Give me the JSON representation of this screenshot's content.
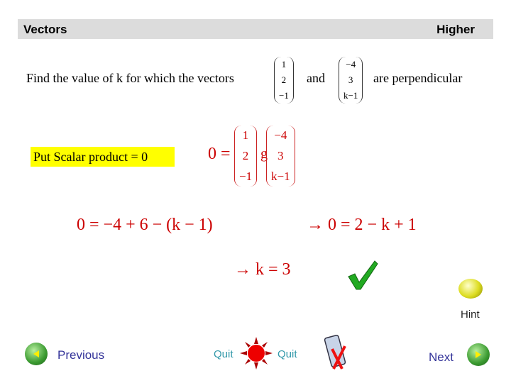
{
  "header": {
    "title": "Vectors",
    "level": "Higher"
  },
  "question": {
    "prefix": "Find the value of  k  for which the vectors",
    "and": "and",
    "suffix": "are perpendicular",
    "vector_a": [
      "1",
      "2",
      "−1"
    ],
    "vector_b": [
      "−4",
      "3",
      "k−1"
    ]
  },
  "hint_box": "Put Scalar product = 0",
  "working": {
    "zero_eq": "0 =",
    "dot": "g",
    "step1": "0 = −4 + 6 − (k − 1)",
    "step2": "→  0 = 2 − k + 1",
    "step3": "→  k = 3"
  },
  "hint": {
    "label": "Hint"
  },
  "nav": {
    "previous": "Previous",
    "quit_left": "Quit",
    "quit_right": "Quit",
    "next": "Next"
  },
  "colors": {
    "header_bg": "#dcdcdc",
    "highlight": "#ffff00",
    "working": "#cc0000",
    "nav_text": "#333399",
    "quit_text": "#3399aa"
  }
}
